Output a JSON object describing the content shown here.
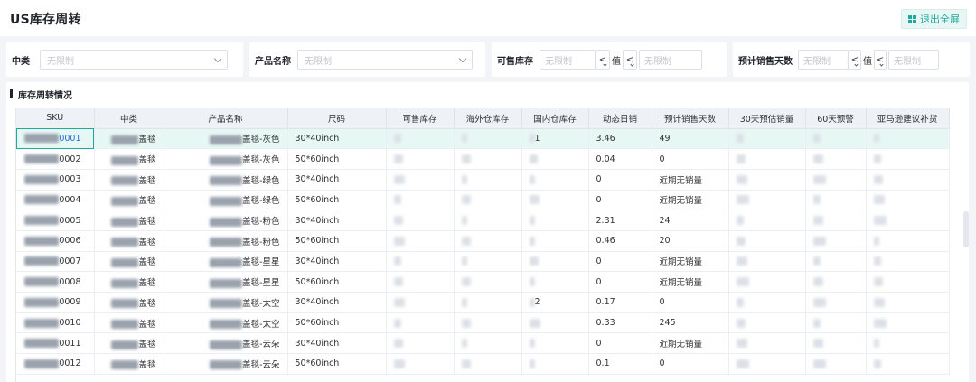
{
  "header": {
    "title": "US库存周转",
    "fullscreen_label": "退出全屏"
  },
  "filters": {
    "category": {
      "label": "中类",
      "placeholder": "无限制"
    },
    "product": {
      "label": "产品名称",
      "placeholder": "无限制"
    },
    "available_stock": {
      "label": "可售库存",
      "min_placeholder": "无限制",
      "op": "<",
      "value_label": "值",
      "op2": "<",
      "max_placeholder": "无限制"
    },
    "forecast_days": {
      "label": "预计销售天数",
      "min_placeholder": "无限制",
      "op": "<",
      "value_label": "值",
      "op2": "<",
      "max_placeholder": "无限制"
    }
  },
  "section": {
    "title": "库存周转情况"
  },
  "table": {
    "columns": [
      "SKU",
      "中类",
      "产品名称",
      "尺码",
      "可售库存",
      "海外仓库存",
      "国内仓库存",
      "动态日销",
      "预计销售天数",
      "30天预估销量",
      "60天预警",
      "亚马逊建议补货"
    ],
    "rows": [
      {
        "sku": "0001",
        "cat": "盖毯",
        "name": "盖毯-灰色",
        "size": "30*40inch",
        "domestic": "1",
        "daily": "3.46",
        "days": "49",
        "selected": true
      },
      {
        "sku": "0002",
        "cat": "盖毯",
        "name": "盖毯-灰色",
        "size": "50*60inch",
        "domestic": "",
        "daily": "0.04",
        "days": "0"
      },
      {
        "sku": "0003",
        "cat": "盖毯",
        "name": "盖毯-绿色",
        "size": "30*40inch",
        "domestic": "",
        "daily": "0",
        "days": "近期无销量"
      },
      {
        "sku": "0004",
        "cat": "盖毯",
        "name": "盖毯-绿色",
        "size": "50*60inch",
        "domestic": "",
        "daily": "0",
        "days": "近期无销量"
      },
      {
        "sku": "0005",
        "cat": "盖毯",
        "name": "盖毯-粉色",
        "size": "30*40inch",
        "domestic": "",
        "daily": "2.31",
        "days": "24"
      },
      {
        "sku": "0006",
        "cat": "盖毯",
        "name": "盖毯-粉色",
        "size": "50*60inch",
        "domestic": "",
        "daily": "0.46",
        "days": "20"
      },
      {
        "sku": "0007",
        "cat": "盖毯",
        "name": "盖毯-星星",
        "size": "30*40inch",
        "domestic": "",
        "daily": "0",
        "days": "近期无销量"
      },
      {
        "sku": "0008",
        "cat": "盖毯",
        "name": "盖毯-星星",
        "size": "50*60inch",
        "domestic": "",
        "daily": "0",
        "days": "近期无销量"
      },
      {
        "sku": "0009",
        "cat": "盖毯",
        "name": "盖毯-太空",
        "size": "30*40inch",
        "domestic": "2",
        "daily": "0.17",
        "days": "0"
      },
      {
        "sku": "0010",
        "cat": "盖毯",
        "name": "盖毯-太空",
        "size": "50*60inch",
        "domestic": "",
        "daily": "0.33",
        "days": "245"
      },
      {
        "sku": "0011",
        "cat": "盖毯",
        "name": "盖毯-云朵",
        "size": "30*40inch",
        "domestic": "",
        "daily": "0",
        "days": "近期无销量"
      },
      {
        "sku": "0012",
        "cat": "盖毯",
        "name": "盖毯-云朵",
        "size": "50*60inch",
        "domestic": "",
        "daily": "0.1",
        "days": "0"
      }
    ]
  },
  "colors": {
    "accent": "#1fa99a",
    "header_bg": "#eef1f5",
    "selected_row": "#e6f7f4"
  }
}
